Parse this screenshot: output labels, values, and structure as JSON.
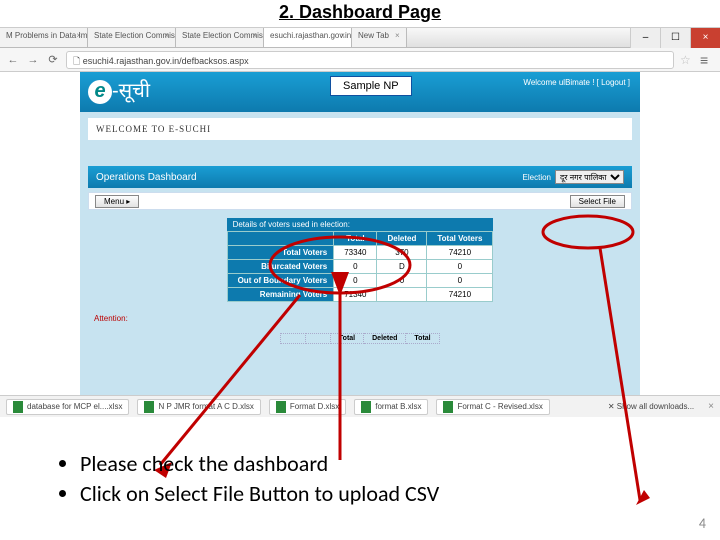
{
  "slide": {
    "title": "2. Dashboard Page",
    "number": "4"
  },
  "annotation": {
    "sample_np": "Sample NP"
  },
  "browser": {
    "tabs": [
      {
        "label": "Problems in Data Import"
      },
      {
        "label": "State Election Commissio"
      },
      {
        "label": "State Election Commissio"
      },
      {
        "label": "esuchi.rajasthan.gov.in/"
      },
      {
        "label": "New Tab"
      }
    ],
    "win": {
      "min": "–",
      "max": "☐",
      "close": "×"
    },
    "url": "esuchi4.rajasthan.gov.in/defbacksos.aspx",
    "nav": {
      "back": "←",
      "fwd": "→",
      "reload": "⟳",
      "star": "☆",
      "menu": "≡"
    }
  },
  "page": {
    "logo_e": "e",
    "logo_hindi": "-सूची",
    "header_right": "Welcome ulBimate ! [ Logout ]",
    "welcome": "WELCOME TO E-SUCHI",
    "ops_title": "Operations Dashboard",
    "election_label": "Election",
    "election_value": "दूर नगर पालिका",
    "menu_label": "Menu ▸",
    "select_file_label": "Select File",
    "table": {
      "caption": "Details of voters used in election:",
      "headers": [
        "",
        "Total",
        "Deleted",
        "Total Voters"
      ],
      "rows": [
        {
          "label": "Total Voters",
          "c1": "73340",
          "c2": "370",
          "c3": "74210"
        },
        {
          "label": "Bifurcated Voters",
          "c1": "0",
          "c2": "D",
          "c3": "0"
        },
        {
          "label": "Out of Boundary Voters",
          "c1": "0",
          "c2": "0",
          "c3": "0"
        },
        {
          "label": "Remaining Voters",
          "c1": "71340",
          "c2": "",
          "c3": "74210"
        }
      ]
    },
    "attention": "Attention:",
    "mini_headers": [
      "Total",
      "Deleted",
      "Total"
    ]
  },
  "downloads": {
    "items": [
      "database for MCP el....xlsx",
      "N P JMR format A C D.xlsx",
      "Format D.xlsx",
      "format B.xlsx",
      "Format C - Revised.xlsx"
    ],
    "show_all": "Show all downloads...",
    "close": "×"
  },
  "bullets": {
    "b1": "Please check the dashboard",
    "b2": "Click on Select File Button to upload CSV"
  }
}
